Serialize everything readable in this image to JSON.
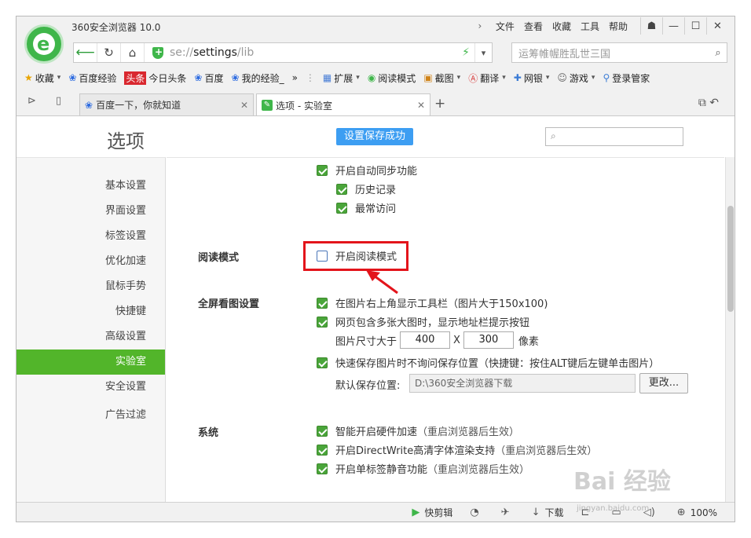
{
  "window": {
    "title": "360安全浏览器 10.0",
    "menu": [
      "文件",
      "查看",
      "收藏",
      "工具",
      "帮助"
    ],
    "menu_arrow": "›"
  },
  "address": {
    "url_prefix": "se://",
    "url_main": "settings",
    "url_suffix": "/lib",
    "search_placeholder": "运筹帷幄胜乱世三国"
  },
  "bookmarks": {
    "items": [
      "收藏",
      "百度经验",
      "今日头条",
      "百度",
      "我的经验_"
    ],
    "more": "»",
    "tools": [
      "扩展",
      "阅读模式",
      "截图",
      "翻译",
      "网银",
      "游戏",
      "登录管家"
    ],
    "toutiao_badge": "头条"
  },
  "tabs": [
    {
      "title": "百度一下，你就知道",
      "active": false
    },
    {
      "title": "选项 - 实验室",
      "active": true
    }
  ],
  "header": {
    "page_title": "选项",
    "save_status": "设置保存成功"
  },
  "sidebar": {
    "items": [
      "基本设置",
      "界面设置",
      "标签设置",
      "优化加速",
      "鼠标手势",
      "快捷键",
      "高级设置",
      "实验室",
      "安全设置",
      "广告过滤"
    ],
    "active_index": 7
  },
  "sync": {
    "enable_label": "开启自动同步功能",
    "history_label": "历史记录",
    "frequent_label": "最常访问"
  },
  "reading_mode": {
    "section": "阅读模式",
    "option_label": "开启阅读模式",
    "checked": false
  },
  "fullscreen_image": {
    "section": "全屏看图设置",
    "toolbar_label": "在图片右上角显示工具栏（图片大于150x100)",
    "multi_image_label": "网页包含多张大图时，显示地址栏提示按钮",
    "size_label": "图片尺寸大于",
    "width": "400",
    "x_label": "X",
    "height": "300",
    "unit": "像素",
    "quick_save_label": "快速保存图片时不询问保存位置（快捷键：按住ALT键后左键单击图片）",
    "default_path_label": "默认保存位置:",
    "default_path": "D:\\360安全浏览器下载",
    "change_button": "更改..."
  },
  "system": {
    "section": "系统",
    "options": [
      {
        "label": "智能开启硬件加速",
        "hint": "（重启浏览器后生效）"
      },
      {
        "label": "开启DirectWrite高清字体渲染支持",
        "hint": "（重启浏览器后生效）"
      },
      {
        "label": "开启单标签静音功能",
        "hint": "（重启浏览器后生效）"
      }
    ]
  },
  "statusbar": {
    "quick_cut": "快剪辑",
    "download": "下载",
    "zoom": "100%"
  },
  "watermark": {
    "main": "Bai 经验",
    "sub": "jingyan.baidu.com"
  },
  "colors": {
    "accent_green": "#52b52a",
    "save_blue": "#3d9ef2",
    "highlight_red": "#e3141b"
  }
}
